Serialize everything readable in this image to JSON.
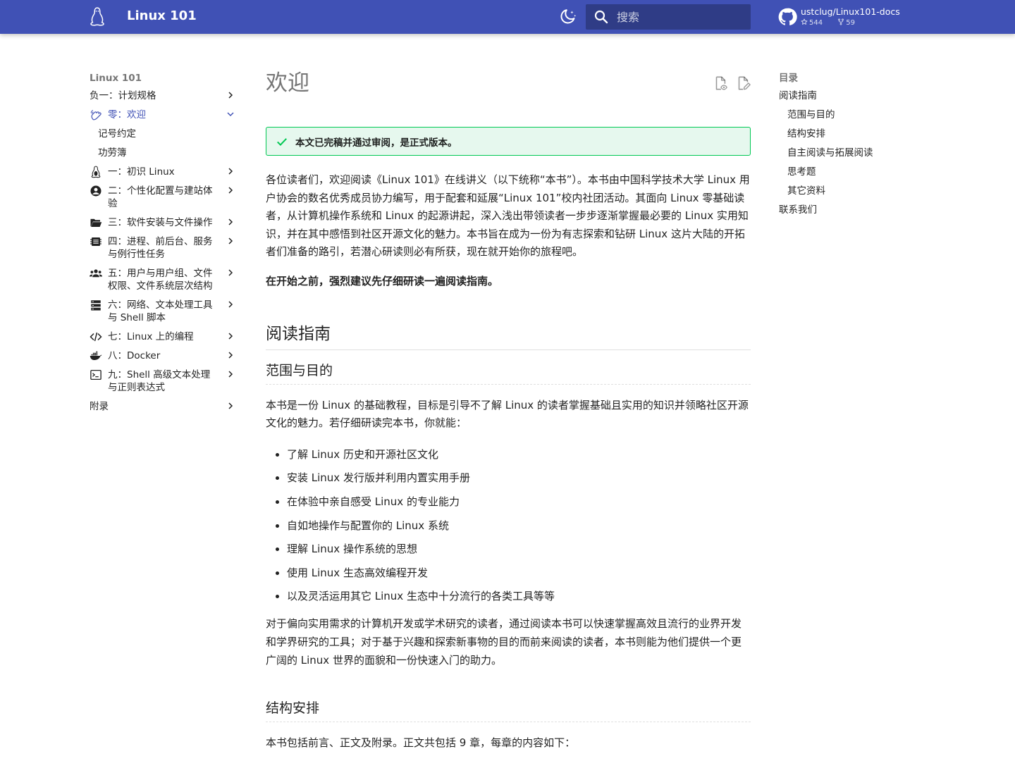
{
  "header": {
    "site_title": "Linux 101",
    "search_placeholder": "搜索",
    "repo": {
      "name": "ustclug/Linux101-docs",
      "stars": "544",
      "forks": "59"
    }
  },
  "nav": {
    "title": "Linux 101",
    "items": [
      {
        "label": "负一：计划规格",
        "icon": "none",
        "chevron": "right"
      },
      {
        "label": "零：欢迎",
        "icon": "hand-wave-icon",
        "chevron": "down",
        "active": true
      },
      {
        "label": "记号约定",
        "sub": true
      },
      {
        "label": "功劳簿",
        "sub": true
      },
      {
        "label": "一：初识 Linux",
        "icon": "penguin-icon",
        "chevron": "right"
      },
      {
        "label": "二：个性化配置与建站体验",
        "icon": "account-circle-icon",
        "chevron": "right"
      },
      {
        "label": "三：软件安装与文件操作",
        "icon": "folder-open-icon",
        "chevron": "right"
      },
      {
        "label": "四：进程、前后台、服务与例行性任务",
        "icon": "memory-icon",
        "chevron": "right"
      },
      {
        "label": "五：用户与用户组、文件权限、文件系统层次结构",
        "icon": "account-group-icon",
        "chevron": "right"
      },
      {
        "label": "六：网络、文本处理工具与 Shell 脚本",
        "icon": "server-icon",
        "chevron": "right"
      },
      {
        "label": "七：Linux 上的编程",
        "icon": "code-icon",
        "chevron": "right"
      },
      {
        "label": "八：Docker",
        "icon": "docker-icon",
        "chevron": "right"
      },
      {
        "label": "九：Shell 高级文本处理与正则表达式",
        "icon": "console-icon",
        "chevron": "right"
      },
      {
        "label": "附录",
        "icon": "none",
        "chevron": "right"
      }
    ]
  },
  "content": {
    "title": "欢迎",
    "admonition": "本文已完稿并通过审阅，是正式版本。",
    "intro": "各位读者们，欢迎阅读《Linux 101》在线讲义（以下统称“本书”）。本书由中国科学技术大学 Linux 用户协会的数名优秀成员协力编写，用于配套和延展“Linux 101”校内社团活动。其面向 Linux 零基础读者，从计算机操作系统和 Linux 的起源讲起，深入浅出带领读者一步步逐渐掌握最必要的 Linux 实用知识，并在其中感悟到社区开源文化的魅力。本书旨在成为一份为有志探索和钻研 Linux 这片大陆的开拓者们准备的路引，若潜心研读则必有所获，现在就开始你的旅程吧。",
    "bold_note": "在开始之前，强烈建议先仔细研读一遍阅读指南。",
    "h2": "阅读指南",
    "h3_scope": "范围与目的",
    "scope_para": "本书是一份 Linux 的基础教程，目标是引导不了解 Linux 的读者掌握基础且实用的知识并领略社区开源文化的魅力。若仔细研读完本书，你就能：",
    "bullets": [
      "了解 Linux 历史和开源社区文化",
      "安装 Linux 发行版并利用内置实用手册",
      "在体验中亲自感受 Linux 的专业能力",
      "自如地操作与配置你的 Linux 系统",
      "理解 Linux 操作系统的思想",
      "使用 Linux 生态高效编程开发",
      "以及灵活运用其它 Linux 生态中十分流行的各类工具等等"
    ],
    "audience_para": "对于偏向实用需求的计算机开发或学术研究的读者，通过阅读本书可以快速掌握高效且流行的业界开发和学界研究的工具；对于基于兴趣和探索新事物的目的而前来阅读的读者，本书则能为他们提供一个更广阔的 Linux 世界的面貌和一份快速入门的助力。",
    "h3_structure": "结构安排",
    "structure_para": "本书包括前言、正文及附录。正文共包括 9 章，每章的内容如下："
  },
  "toc": {
    "title": "目录",
    "items": [
      {
        "label": "阅读指南"
      },
      {
        "label": "范围与目的",
        "sub": true
      },
      {
        "label": "结构安排",
        "sub": true
      },
      {
        "label": "自主阅读与拓展阅读",
        "sub": true
      },
      {
        "label": "思考题",
        "sub": true
      },
      {
        "label": "其它资料",
        "sub": true
      },
      {
        "label": "联系我们"
      }
    ]
  },
  "colors": {
    "primary": "#4051b5",
    "success": "#00c853",
    "success_bg": "#e6f8ee"
  }
}
